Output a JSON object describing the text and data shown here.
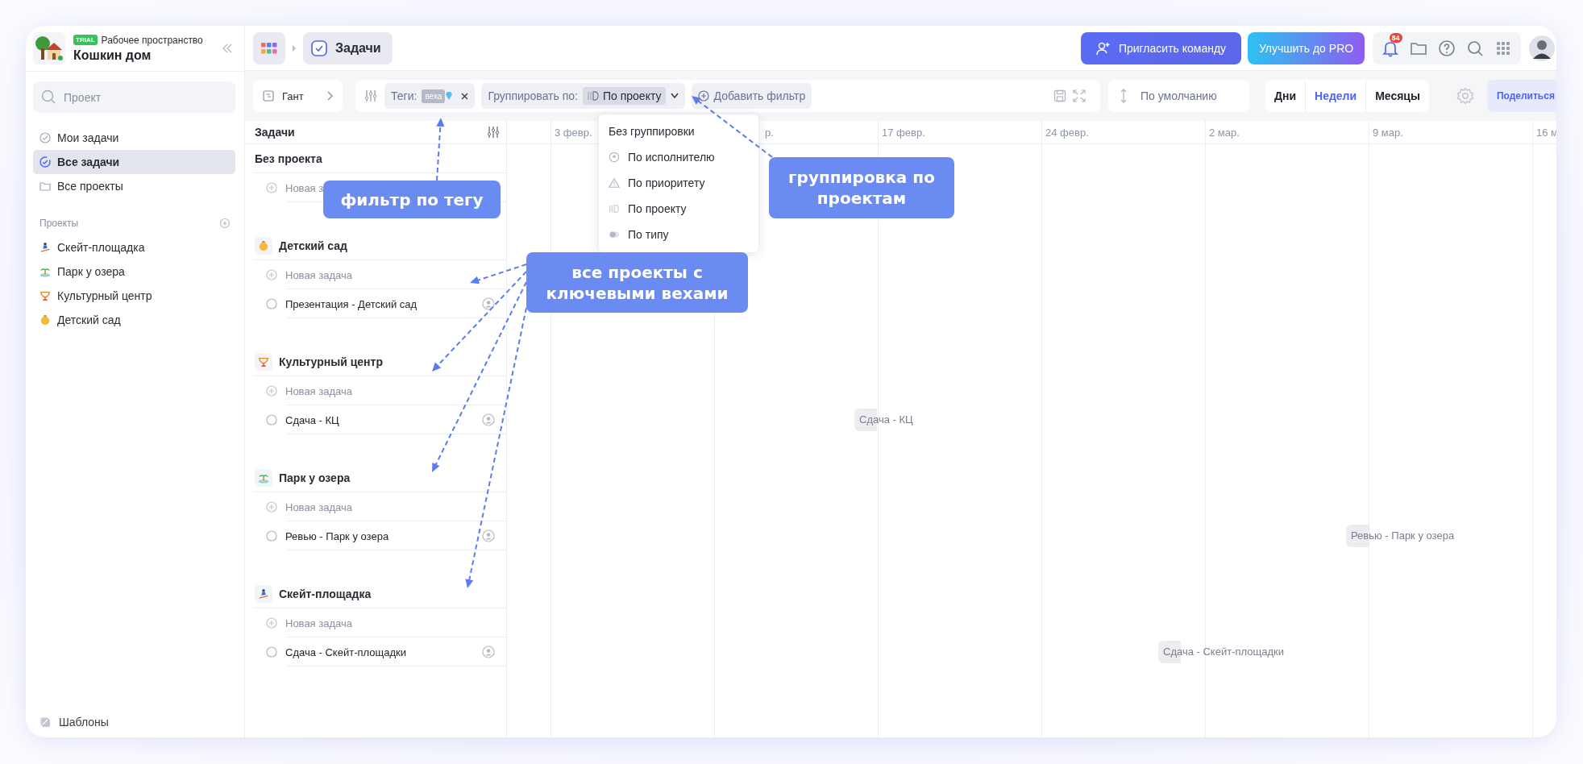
{
  "workspace": {
    "badge": "TRIAL",
    "label": "Рабочее пространство",
    "name": "Кошкин дом"
  },
  "sidebar": {
    "search": {
      "placeholder": "Проект"
    },
    "nav": [
      {
        "label": "Мои задачи",
        "kind": "mine",
        "selected": false
      },
      {
        "label": "Все задачи",
        "kind": "all",
        "selected": true
      },
      {
        "label": "Все проекты",
        "kind": "folder",
        "selected": false
      }
    ],
    "projects_title": "Проекты",
    "projects": [
      {
        "label": "Скейт-площадка",
        "kind": "skate"
      },
      {
        "label": "Парк у озера",
        "kind": "island"
      },
      {
        "label": "Культурный центр",
        "kind": "trophy"
      },
      {
        "label": "Детский сад",
        "kind": "child"
      }
    ],
    "templates": "Шаблоны"
  },
  "topbar": {
    "section": "Задачи",
    "invite": "Пригласить команду",
    "upgrade": "Улучшить до PRO",
    "notifications": "84"
  },
  "toolbar": {
    "view": "Гант",
    "tag_label": "Теги:",
    "tag": "веха",
    "group_label": "Группировать по:",
    "group_value": "По проекту",
    "add_filter": "Добавить фильтр",
    "sort": "По умолчанию",
    "scales": [
      {
        "label": "Дни",
        "selected": false
      },
      {
        "label": "Недели",
        "selected": true
      },
      {
        "label": "Месяцы",
        "selected": false
      }
    ],
    "share": "Поделиться"
  },
  "group_menu": [
    {
      "label": "Без группировки",
      "kind": "none"
    },
    {
      "label": "По исполнителю",
      "kind": "assignee"
    },
    {
      "label": "По приоритету",
      "kind": "priority"
    },
    {
      "label": "По проекту",
      "kind": "project"
    },
    {
      "label": "По типу",
      "kind": "type"
    }
  ],
  "tasks": {
    "title": "Задачи",
    "groups": [
      {
        "name": "Без проекта",
        "kind": "none",
        "new_task": "Новая з"
      },
      {
        "name": "Детский сад",
        "kind": "child",
        "new_task": "Новая задача",
        "tasks": [
          {
            "label": "Презентация - Детский сад",
            "checked": false
          }
        ]
      },
      {
        "name": "Культурный центр",
        "kind": "trophy",
        "new_task": "Новая задача",
        "tasks": [
          {
            "label": "Сдача - КЦ",
            "checked": false,
            "bar": "Сдача - КЦ"
          }
        ]
      },
      {
        "name": "Парк у озера",
        "kind": "island",
        "new_task": "Новая задача",
        "tasks": [
          {
            "label": "Ревью - Парк у озера",
            "checked": false,
            "bar": "Ревью - Парк у озера"
          }
        ]
      },
      {
        "name": "Скейт-площадка",
        "kind": "skate",
        "new_task": "Новая задача",
        "tasks": [
          {
            "label": "Сдача - Скейт-площадки",
            "checked": false,
            "bar": "Сдача - Скейт-площадки"
          }
        ]
      }
    ]
  },
  "timeline": {
    "dates": [
      {
        "label": "3 февр.",
        "kind": "full"
      },
      {
        "label": "р.",
        "kind": "partial"
      },
      {
        "label": "17 февр.",
        "kind": "full"
      },
      {
        "label": "24 февр.",
        "kind": "full"
      },
      {
        "label": "2 мар.",
        "kind": "full"
      },
      {
        "label": "9 мар.",
        "kind": "full"
      },
      {
        "label": "16 м",
        "kind": "full"
      }
    ]
  },
  "annotations": [
    {
      "text": "фильтр по тегу"
    },
    {
      "text": "группировка по проектам"
    },
    {
      "text": "все проекты с ключевыми вехами"
    }
  ]
}
